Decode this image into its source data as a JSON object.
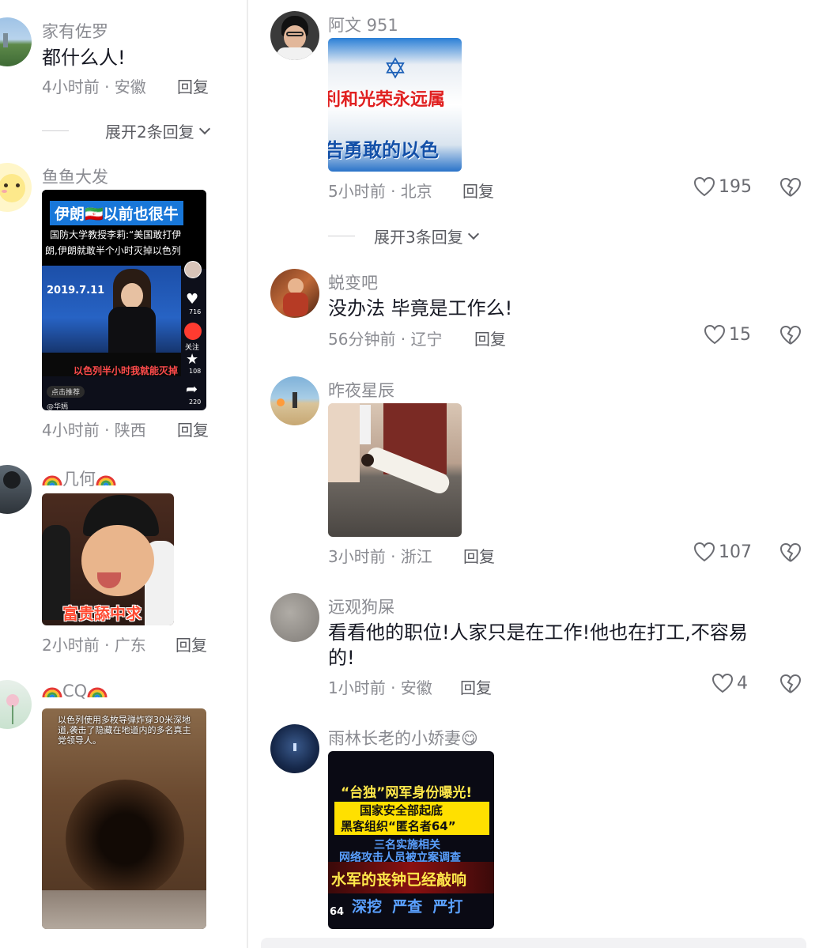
{
  "left": {
    "comments": [
      {
        "user": "家有佐罗",
        "text": "都什么人!",
        "meta": "4小时前 · 安徽",
        "reply": "回复",
        "expand": "展开2条回复"
      },
      {
        "user": "鱼鱼大发",
        "meta": "4小时前 · 陕西",
        "reply": "回复",
        "media": {
          "banner": "伊朗🇮🇷以前也很牛",
          "line1": "国防大学教授李莉:“美国敢打伊",
          "line2": "朗,伊朗就敢半个小时灭掉以色列",
          "date": "2019.7.11",
          "subtitle": "以色列半小时我就能灭掉",
          "recommend": "点击推荐",
          "handle": "@华嫣",
          "side_count1": "716",
          "side_count2": "108",
          "side_count3": "220",
          "follow": "关注"
        }
      },
      {
        "user": "几何",
        "meta": "2小时前 · 广东",
        "reply": "回复",
        "media": {
          "caption": "富贵舔中求"
        }
      },
      {
        "user": "CQ",
        "meta": "",
        "media": {
          "caption": "以色列使用多枚导弹炸穿30米深地道,袭击了隐藏在地道内的多名真主党领导人。"
        }
      }
    ]
  },
  "right": {
    "comments": [
      {
        "user": "阿文 951",
        "meta": "5小时前 · 北京",
        "reply": "回复",
        "likes": "195",
        "expand": "展开3条回复",
        "media": {
          "line1": "利和光荣永远属",
          "line2": "告勇敢的以色"
        }
      },
      {
        "user": "蜕变吧",
        "text": "没办法 毕竟是工作么!",
        "meta": "56分钟前 · 辽宁",
        "reply": "回复",
        "likes": "15"
      },
      {
        "user": "昨夜星辰",
        "meta": "3小时前 · 浙江",
        "reply": "回复",
        "likes": "107"
      },
      {
        "user": "远观狗屎",
        "text_line1": "看看他的职位!人家只是在工作!他也在打工,不容易",
        "text_line2": "的!",
        "meta": "1小时前 · 安徽",
        "reply": "回复",
        "likes": "4"
      },
      {
        "user": "雨林长老的小娇妻😋",
        "media": {
          "l1": "“台独”网军身份曝光!",
          "l2": "国家安全部起底",
          "l3": "黑客组织“匿名者64”",
          "l4": "三名实施相关",
          "l5": "网络攻击人员被立案调查",
          "l6": "水军的丧钟已经敲响",
          "l7": "深挖  严查  严打",
          "corner": "64"
        }
      }
    ]
  },
  "colors": {
    "text": "#161823",
    "secondary": "#8a8b91",
    "accent": "#fe2c55"
  }
}
